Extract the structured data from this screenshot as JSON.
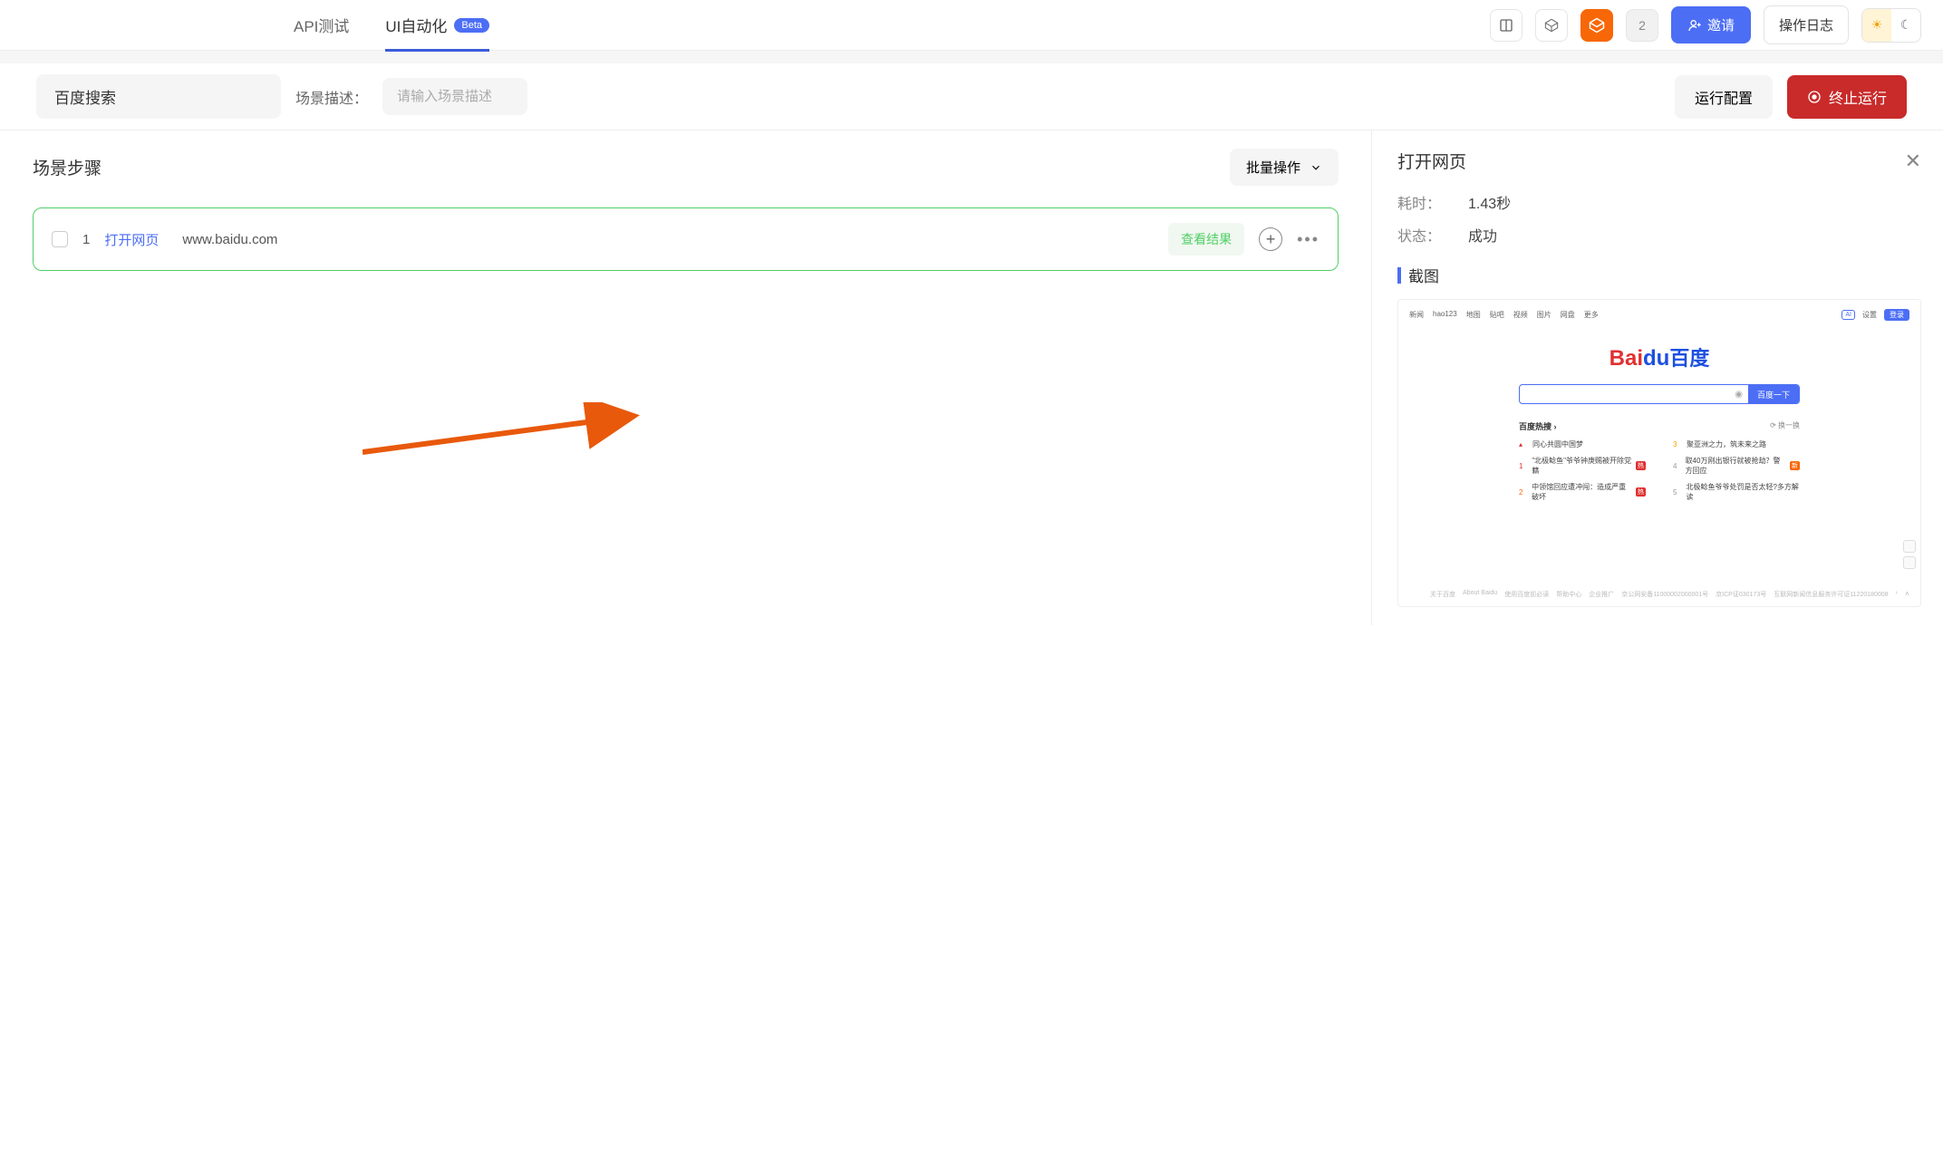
{
  "nav": {
    "tab_api": "API测试",
    "tab_ui": "UI自动化",
    "beta": "Beta",
    "count": "2",
    "invite": "邀请",
    "log": "操作日志"
  },
  "subheader": {
    "scene_name": "百度搜索",
    "desc_label": "场景描述：",
    "desc_placeholder": "请输入场景描述",
    "config": "运行配置",
    "stop": "终止运行"
  },
  "left": {
    "title": "场景步骤",
    "batch": "批量操作",
    "step": {
      "num": "1",
      "action": "打开网页",
      "target": "www.baidu.com",
      "view_result": "查看结果"
    }
  },
  "right": {
    "title": "打开网页",
    "time_label": "耗时：",
    "time_value": "1.43秒",
    "status_label": "状态：",
    "status_value": "成功",
    "screenshot_label": "截图"
  },
  "ss": {
    "nav": [
      "新闻",
      "hao123",
      "地图",
      "贴吧",
      "视频",
      "图片",
      "网盘",
      "更多"
    ],
    "settings": "设置",
    "login": "登录",
    "search_btn": "百度一下",
    "logo_bai": "Bai",
    "logo_du": "du",
    "logo_cn": "百度",
    "hot_title": "百度热搜 ›",
    "hot_refresh": "⟳ 换一换",
    "hot_left": [
      {
        "rank": "▴",
        "text": "同心共圆中国梦",
        "cls": "top"
      },
      {
        "rank": "1",
        "text": "\"北极鲶鱼\"爷爷钟庚赐被开除党籍",
        "tag": "热",
        "cls": "r1"
      },
      {
        "rank": "2",
        "text": "中领馆回应遭冲闯：造成严重破坏",
        "tag": "热",
        "cls": "r2"
      }
    ],
    "hot_right": [
      {
        "rank": "3",
        "text": "聚亚洲之力，筑未来之路",
        "cls": "r3"
      },
      {
        "rank": "4",
        "text": "取40万刚出银行就被抢劫？警方回应",
        "tag": "新",
        "tagcls": "orange",
        "cls": "r4"
      },
      {
        "rank": "5",
        "text": "北极鲶鱼爷爷处罚是否太轻?多方解读",
        "cls": "r5"
      }
    ],
    "footer": [
      "关于百度",
      "About Baidu",
      "使用百度前必读",
      "帮助中心",
      "企业推广",
      "京公网安备11000002000001号",
      "京ICP证030173号",
      "互联网新闻信息服务许可证11220180008",
      "›",
      "∧"
    ]
  }
}
